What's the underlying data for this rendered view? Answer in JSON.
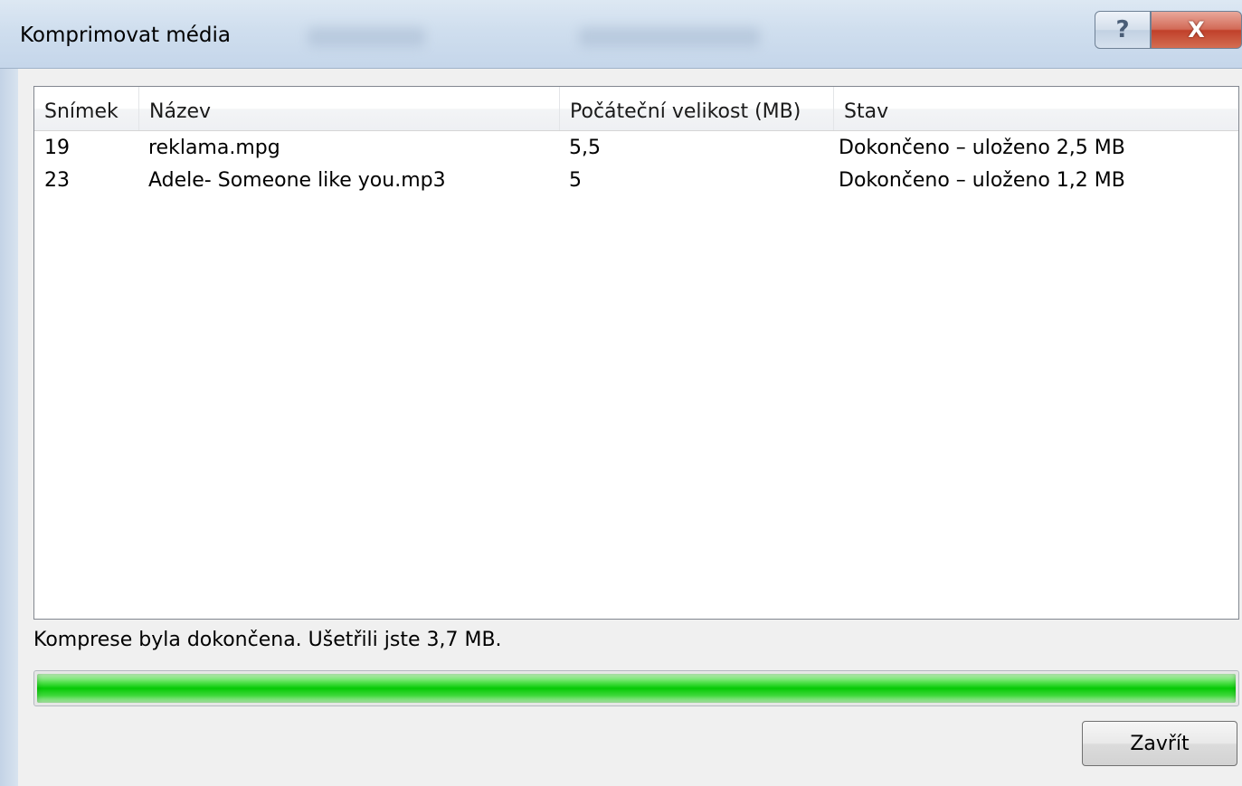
{
  "window": {
    "title": "Komprimovat média",
    "help_glyph": "?",
    "close_glyph": "X"
  },
  "table": {
    "columns": [
      "Snímek",
      "Název",
      "Počáteční velikost (MB)",
      "Stav"
    ],
    "rows": [
      {
        "slide": "19",
        "name": "reklama.mpg",
        "size": "5,5",
        "status": "Dokončeno – uloženo 2,5 MB"
      },
      {
        "slide": "23",
        "name": "Adele- Someone like you.mp3",
        "size": "5",
        "status": "Dokončeno – uloženo 1,2 MB"
      }
    ]
  },
  "status_message": "Komprese byla dokončena. Ušetřili jste 3,7 MB.",
  "progress": {
    "percent": 100,
    "color": "#06c906"
  },
  "buttons": {
    "close_label": "Zavřít"
  },
  "icons": {
    "help": "help-question-icon",
    "close": "close-x-icon"
  }
}
